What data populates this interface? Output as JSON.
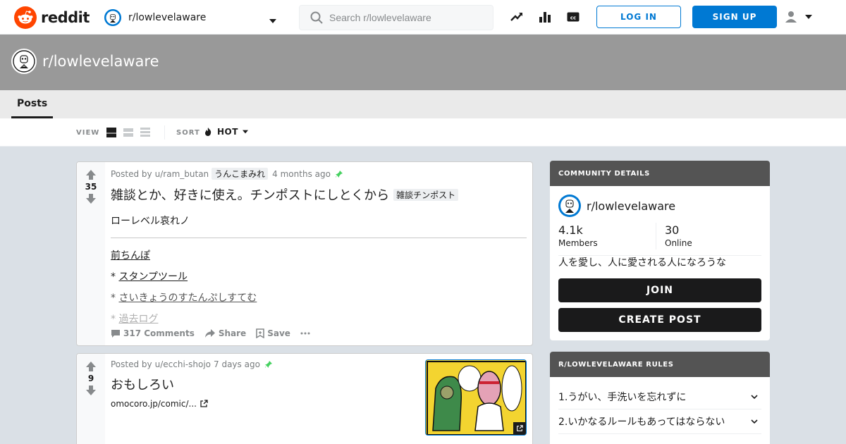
{
  "header": {
    "logo_text": "reddit",
    "community": "r/lowlevelaware",
    "search_placeholder": "Search r/lowlevelaware",
    "icons": [
      "trending-icon",
      "leaderboard-icon",
      "closed-caption-icon"
    ],
    "login_label": "LOG IN",
    "signup_label": "SIGN UP"
  },
  "banner": {
    "title": "r/lowlevelaware"
  },
  "tabs": [
    {
      "label": "Posts"
    }
  ],
  "viewbar": {
    "view_label": "VIEW",
    "sort_label": "SORT",
    "sort_value": "HOT"
  },
  "posts": [
    {
      "score": "35",
      "posted_by": "Posted by",
      "user": "u/ram_butan",
      "user_flair": "うんこまみれ",
      "time": "4 months ago",
      "title": "雑談とか、好きに使え。チンポストにしとくから",
      "title_flair": "雑談チンポスト",
      "body_line": "ローレベル哀れノ",
      "links": [
        "前ちんぽ",
        "スタンプツール",
        "さいきょうのすたんぷしすてむ",
        "過去ログ"
      ],
      "bullet": "*",
      "comments": "317 Comments",
      "share": "Share",
      "save": "Save"
    },
    {
      "score": "9",
      "posted_by": "Posted by",
      "user": "u/ecchi-shojo",
      "time": "7 days ago",
      "title": "おもしろい",
      "domain": "omocoro.jp/comic/..."
    }
  ],
  "sidebar": {
    "details_header": "COMMUNITY DETAILS",
    "community": "r/lowlevelaware",
    "members_count": "4.1k",
    "members_label": "Members",
    "online_count": "30",
    "online_label": "Online",
    "description": "人を愛し、人に愛される人になろうな",
    "join_label": "JOIN",
    "create_post_label": "CREATE POST",
    "rules_header": "R/LOWLEVELAWARE RULES",
    "rules": [
      {
        "label": "1.うがい、手洗いを忘れずに"
      },
      {
        "label": "2.いかなるルールもあってはならない"
      }
    ]
  },
  "colors": {
    "brand": "#ff4500",
    "accent": "#0079d3",
    "banner": "#999999",
    "pin": "#46d160"
  }
}
